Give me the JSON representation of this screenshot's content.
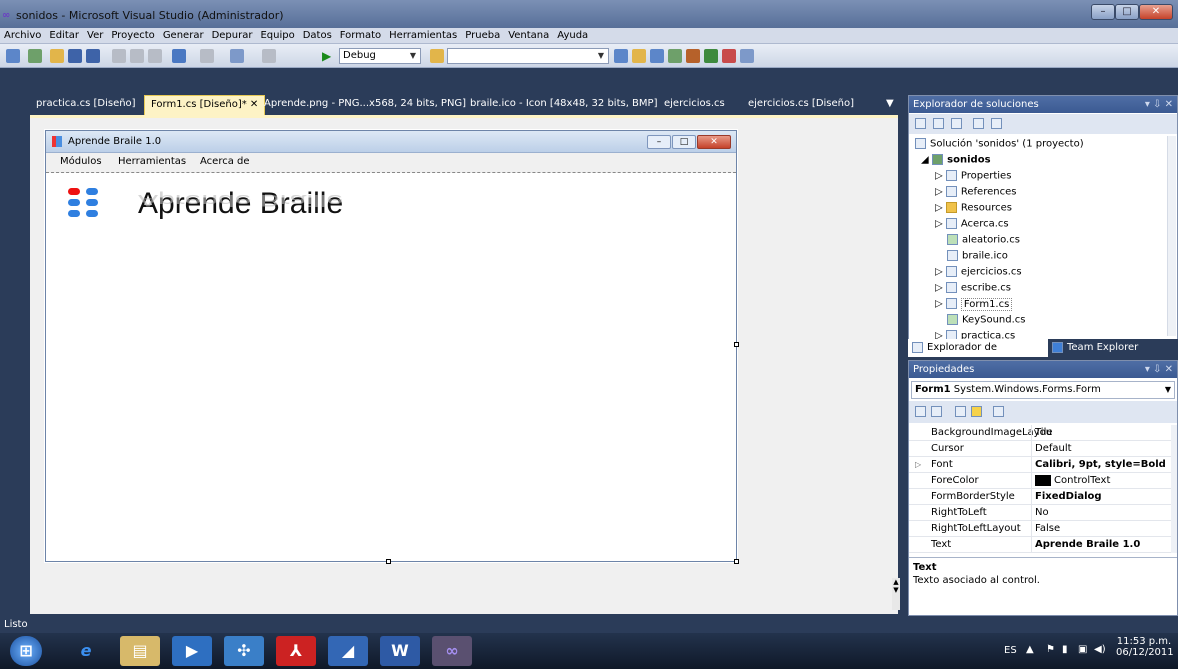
{
  "window": {
    "title": "sonidos - Microsoft Visual Studio (Administrador)",
    "app_icon": "vs-infinity-icon"
  },
  "menu": [
    "Archivo",
    "Editar",
    "Ver",
    "Proyecto",
    "Generar",
    "Depurar",
    "Equipo",
    "Datos",
    "Formato",
    "Herramientas",
    "Prueba",
    "Ventana",
    "Ayuda"
  ],
  "toolbar": {
    "config": "Debug",
    "search": ""
  },
  "tabs": [
    {
      "label": "practica.cs [Diseño]"
    },
    {
      "label": "Form1.cs [Diseño]*"
    },
    {
      "label": "Aprende.png - PNG...x568, 24 bits, PNG]"
    },
    {
      "label": "braile.ico - Icon [48x48, 32 bits, BMP]"
    },
    {
      "label": "ejercicios.cs"
    },
    {
      "label": "ejercicios.cs [Diseño]"
    }
  ],
  "form": {
    "title": "Aprende Braile 1.0",
    "menu": [
      "Módulos",
      "Herramientas",
      "Acerca de"
    ],
    "logo_text": "Aprende Braille"
  },
  "solution_explorer": {
    "title": "Explorador de soluciones",
    "solution": "Solución 'sonidos' (1 proyecto)",
    "project": "sonidos",
    "items": [
      "Properties",
      "References",
      "Resources",
      "Acerca.cs",
      "aleatorio.cs",
      "braile.ico",
      "ejercicios.cs",
      "escribe.cs",
      "Form1.cs",
      "KeySound.cs",
      "practica.cs"
    ],
    "tab_se": "Explorador de soluciones",
    "tab_te": "Team Explorer"
  },
  "properties": {
    "title": "Propiedades",
    "object": "Form1",
    "object_type": "System.Windows.Forms.Form",
    "rows": [
      {
        "name": "BackgroundImageLayou",
        "value": "Tile"
      },
      {
        "name": "Cursor",
        "value": "Default"
      },
      {
        "name": "Font",
        "value": "Calibri, 9pt, style=Bold"
      },
      {
        "name": "ForeColor",
        "value": "ControlText"
      },
      {
        "name": "FormBorderStyle",
        "value": "FixedDialog"
      },
      {
        "name": "RightToLeft",
        "value": "No"
      },
      {
        "name": "RightToLeftLayout",
        "value": "False"
      },
      {
        "name": "Text",
        "value": "Aprende Braile 1.0"
      }
    ],
    "desc_title": "Text",
    "desc_text": "Texto asociado al control."
  },
  "status": "Listo",
  "tray": {
    "lang": "ES",
    "time": "11:53 p.m.",
    "date": "06/12/2011"
  },
  "colors": {
    "accent_tab": "#fdf3c5",
    "panel_title": "#3b5a92",
    "background": "#2b3c59"
  }
}
